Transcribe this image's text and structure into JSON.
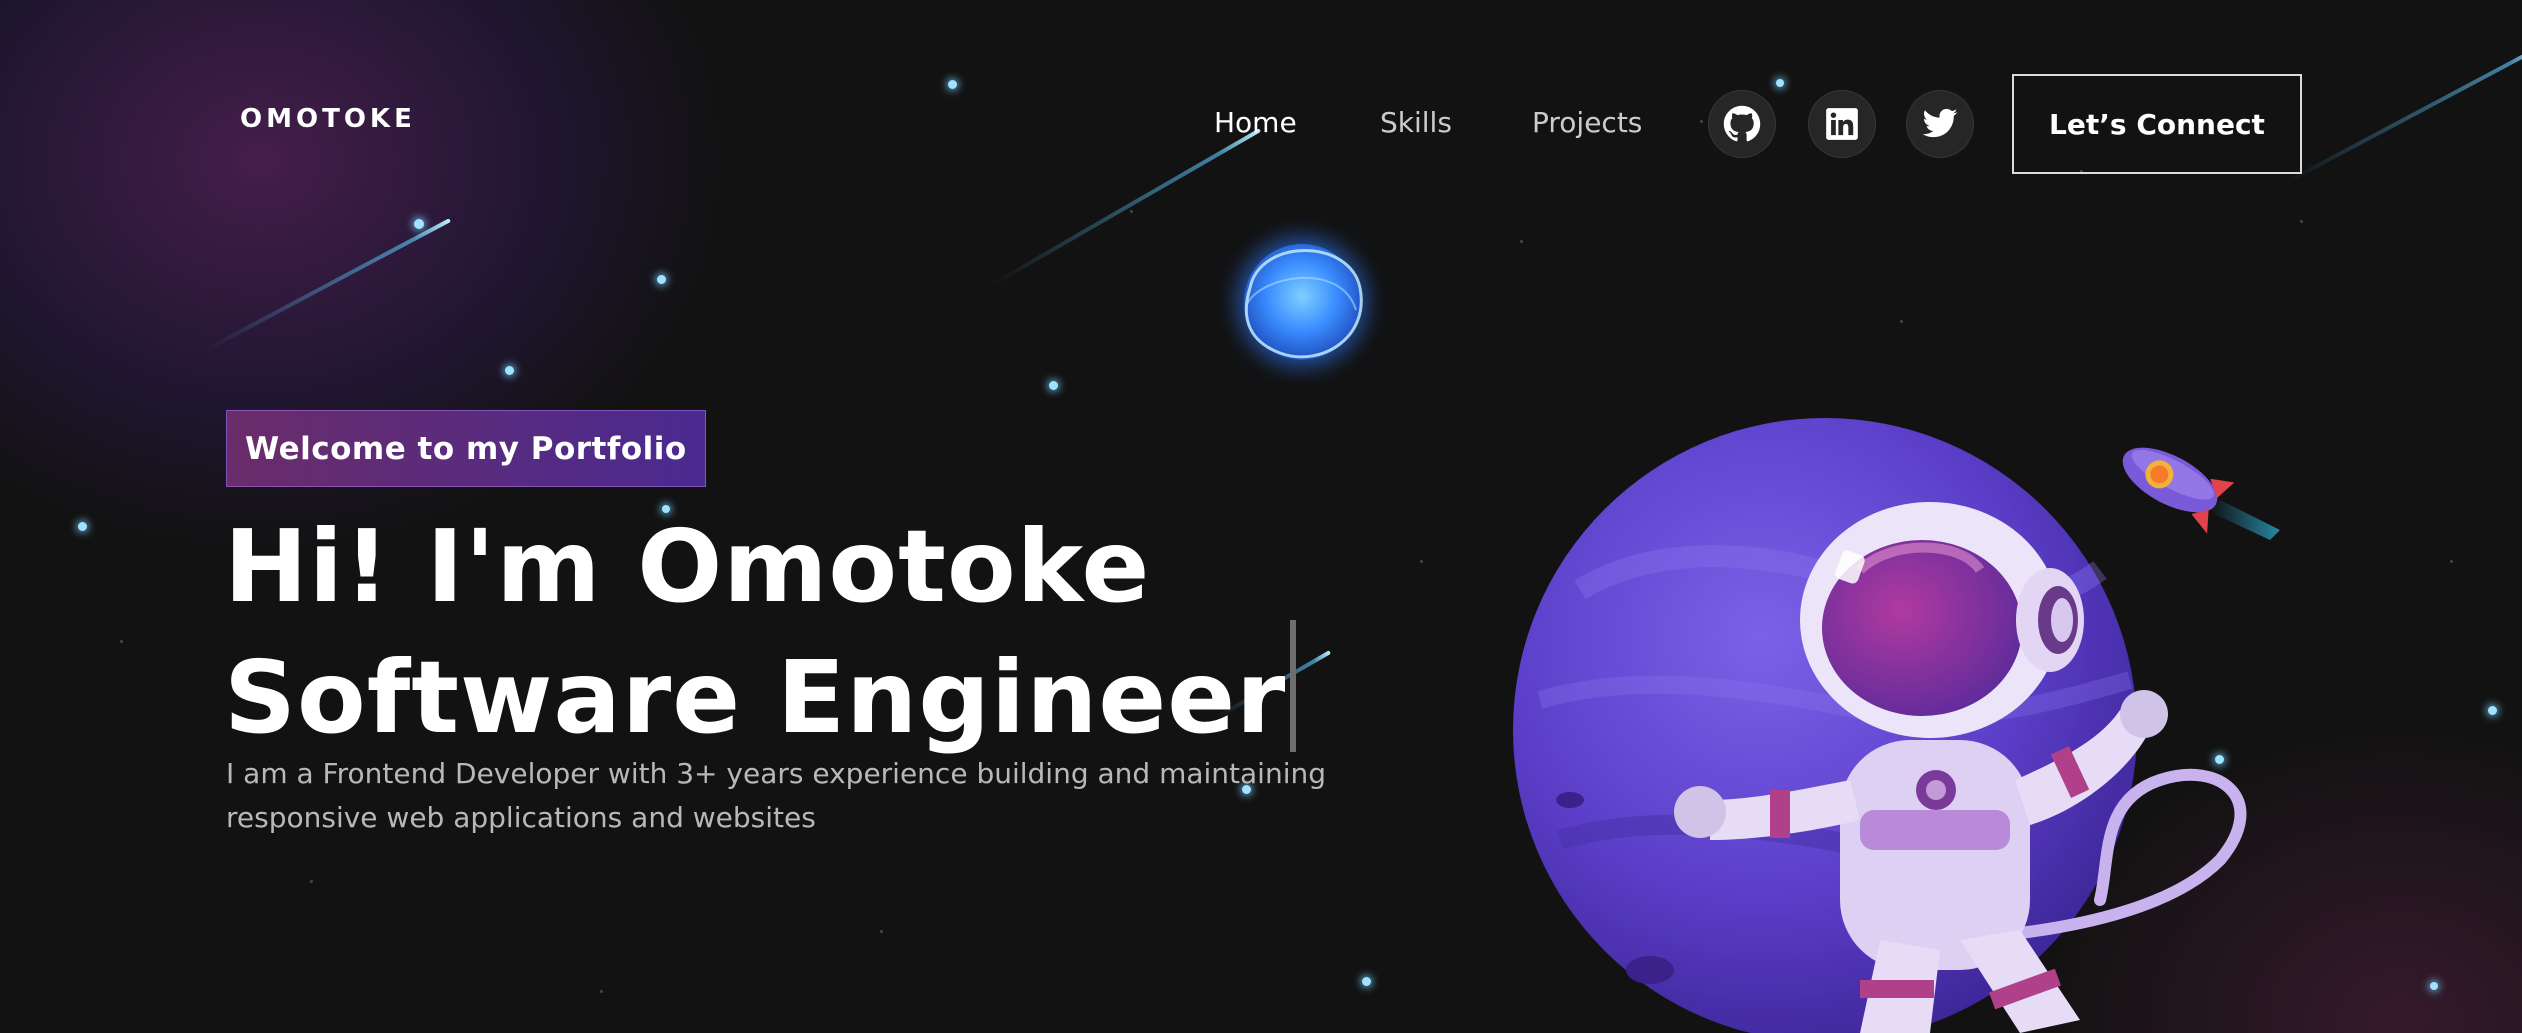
{
  "brand": {
    "logo": "OMOTOKE"
  },
  "nav": {
    "links": [
      {
        "label": "Home",
        "active": true
      },
      {
        "label": "Skills",
        "active": false
      },
      {
        "label": "Projects",
        "active": false
      }
    ],
    "social_icons": [
      "github-icon",
      "linkedin-icon",
      "twitter-icon"
    ],
    "cta_label": "Let’s Connect"
  },
  "hero": {
    "tagline": "Welcome to my Portfolio",
    "headline_line1": "Hi! I'm Omotoke",
    "headline_line2": "Software Engineer",
    "description": "I am a Frontend Developer with 3+ years experience building and maintaining responsive web applications and websites"
  },
  "colors": {
    "background": "#121212",
    "tagline_gradient_start": "#6a2c6a",
    "tagline_gradient_end": "#4a2a90",
    "planet": "#6a4ad0",
    "star": "#9fe3ff"
  }
}
